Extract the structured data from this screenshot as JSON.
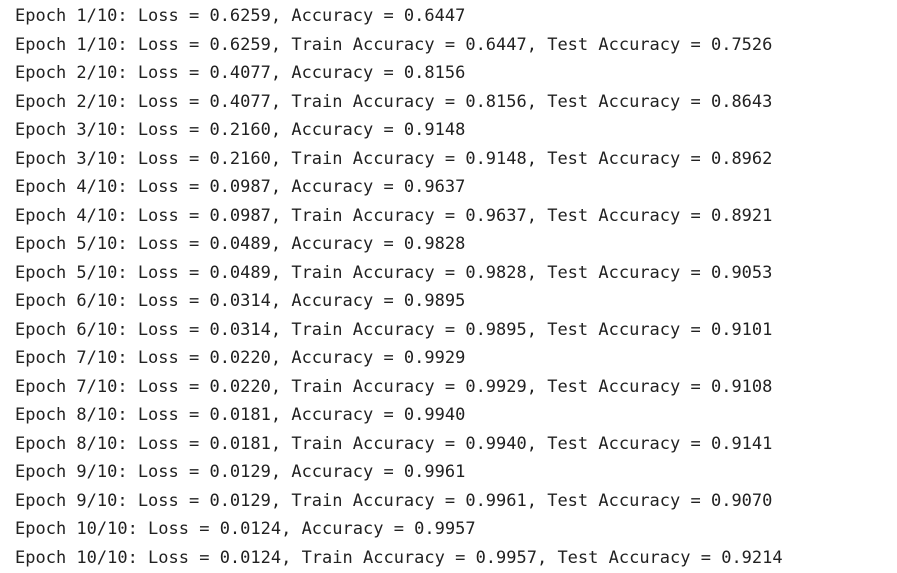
{
  "output": {
    "lines": [
      "Epoch 1/10: Loss = 0.6259, Accuracy = 0.6447",
      "Epoch 1/10: Loss = 0.6259, Train Accuracy = 0.6447, Test Accuracy = 0.7526",
      "Epoch 2/10: Loss = 0.4077, Accuracy = 0.8156",
      "Epoch 2/10: Loss = 0.4077, Train Accuracy = 0.8156, Test Accuracy = 0.8643",
      "Epoch 3/10: Loss = 0.2160, Accuracy = 0.9148",
      "Epoch 3/10: Loss = 0.2160, Train Accuracy = 0.9148, Test Accuracy = 0.8962",
      "Epoch 4/10: Loss = 0.0987, Accuracy = 0.9637",
      "Epoch 4/10: Loss = 0.0987, Train Accuracy = 0.9637, Test Accuracy = 0.8921",
      "Epoch 5/10: Loss = 0.0489, Accuracy = 0.9828",
      "Epoch 5/10: Loss = 0.0489, Train Accuracy = 0.9828, Test Accuracy = 0.9053",
      "Epoch 6/10: Loss = 0.0314, Accuracy = 0.9895",
      "Epoch 6/10: Loss = 0.0314, Train Accuracy = 0.9895, Test Accuracy = 0.9101",
      "Epoch 7/10: Loss = 0.0220, Accuracy = 0.9929",
      "Epoch 7/10: Loss = 0.0220, Train Accuracy = 0.9929, Test Accuracy = 0.9108",
      "Epoch 8/10: Loss = 0.0181, Accuracy = 0.9940",
      "Epoch 8/10: Loss = 0.0181, Train Accuracy = 0.9940, Test Accuracy = 0.9141",
      "Epoch 9/10: Loss = 0.0129, Accuracy = 0.9961",
      "Epoch 9/10: Loss = 0.0129, Train Accuracy = 0.9961, Test Accuracy = 0.9070",
      "Epoch 10/10: Loss = 0.0124, Accuracy = 0.9957",
      "Epoch 10/10: Loss = 0.0124, Train Accuracy = 0.9957, Test Accuracy = 0.9214"
    ]
  }
}
